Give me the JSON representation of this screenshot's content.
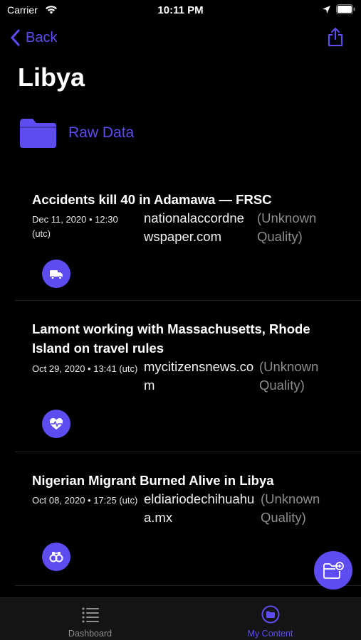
{
  "status_bar": {
    "carrier": "Carrier",
    "time": "10:11 PM"
  },
  "nav": {
    "back_label": "Back"
  },
  "page": {
    "title": "Libya"
  },
  "raw_data": {
    "label": "Raw Data"
  },
  "articles": [
    {
      "title": "Accidents kill 40 in Adamawa — FRSC",
      "date": "Dec 11, 2020 • 12:30 (utc)",
      "source": "nationalaccordnewspaper.com",
      "quality": "(Unknown Quality)",
      "badge_icon": "truck-icon"
    },
    {
      "title": "Lamont working with Massachusetts, Rhode Island on travel rules",
      "date": "Oct 29, 2020 • 13:41 (utc)",
      "source": "mycitizensnews.com",
      "quality": "(Unknown Quality)",
      "badge_icon": "heartbeat-icon"
    },
    {
      "title": "Nigerian Migrant Burned Alive in Libya",
      "date": "Oct 08, 2020 • 17:25 (utc)",
      "source": "eldiariodechihuahua.mx",
      "quality": "(Unknown Quality)",
      "badge_icon": "handcuffs-icon"
    }
  ],
  "fab": {
    "icon": "add-folder-icon"
  },
  "tabs": [
    {
      "label": "Dashboard",
      "icon": "list-icon",
      "active": false
    },
    {
      "label": "My Content",
      "icon": "folder-circle-icon",
      "active": true
    }
  ],
  "colors": {
    "accent": "#5d4cf0",
    "background": "#000000",
    "tab_inactive": "#8e8e93",
    "quality_text": "#8d8d8d"
  }
}
